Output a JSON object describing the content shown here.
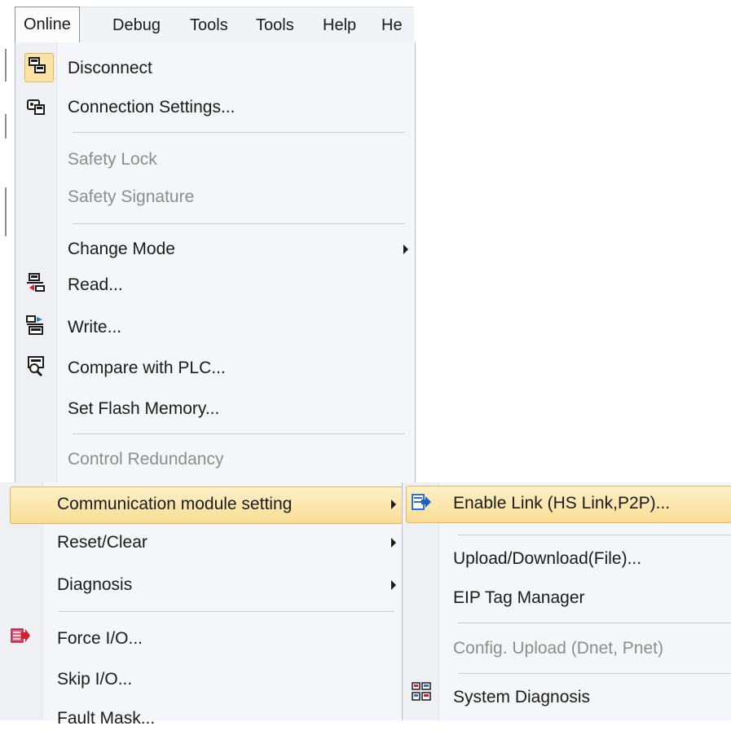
{
  "menubar": {
    "items": [
      {
        "label": "Online",
        "active": true
      },
      {
        "label": "Debug"
      },
      {
        "label": "Tools"
      },
      {
        "label": "Tools"
      },
      {
        "label": "Help"
      },
      {
        "label": "He"
      }
    ]
  },
  "menu": {
    "items": [
      {
        "label": "Disconnect",
        "icon": "disconnect-icon",
        "enabled": true
      },
      {
        "label": "Connection Settings...",
        "icon": "connection-settings-icon",
        "enabled": true
      },
      {
        "label": "Safety Lock",
        "enabled": false
      },
      {
        "label": "Safety Signature",
        "enabled": false
      },
      {
        "label": "Change Mode",
        "enabled": true,
        "submenu": true
      },
      {
        "label": "Read...",
        "icon": "read-icon",
        "enabled": true
      },
      {
        "label": "Write...",
        "icon": "write-icon",
        "enabled": true
      },
      {
        "label": "Compare with PLC...",
        "icon": "compare-icon",
        "enabled": true
      },
      {
        "label": "Set Flash Memory...",
        "enabled": true
      },
      {
        "label": "Control Redundancy",
        "enabled": false
      },
      {
        "label": "Communication module setting",
        "enabled": true,
        "submenu": true,
        "highlighted": true
      },
      {
        "label": "Reset/Clear",
        "enabled": true,
        "submenu": true
      },
      {
        "label": "Diagnosis",
        "enabled": true,
        "submenu": true
      },
      {
        "label": "Force I/O...",
        "icon": "force-io-icon",
        "enabled": true
      },
      {
        "label": "Skip I/O...",
        "enabled": true
      },
      {
        "label": "Fault Mask...",
        "enabled": true
      }
    ]
  },
  "submenu": {
    "items": [
      {
        "label": "Enable Link (HS Link,P2P)...",
        "icon": "enable-link-icon",
        "enabled": true,
        "highlighted": true
      },
      {
        "label": "Upload/Download(File)...",
        "enabled": true
      },
      {
        "label": "EIP Tag Manager",
        "enabled": true
      },
      {
        "label": "Config. Upload (Dnet, Pnet)",
        "enabled": false
      },
      {
        "label": "System Diagnosis",
        "icon": "system-diagnosis-icon",
        "enabled": true
      }
    ]
  },
  "colors": {
    "highlight_border": "#e2b45b",
    "highlight_fill": "#f9dd95",
    "disabled_text": "#8d8d8d",
    "menu_bg": "#f5f6f9"
  }
}
